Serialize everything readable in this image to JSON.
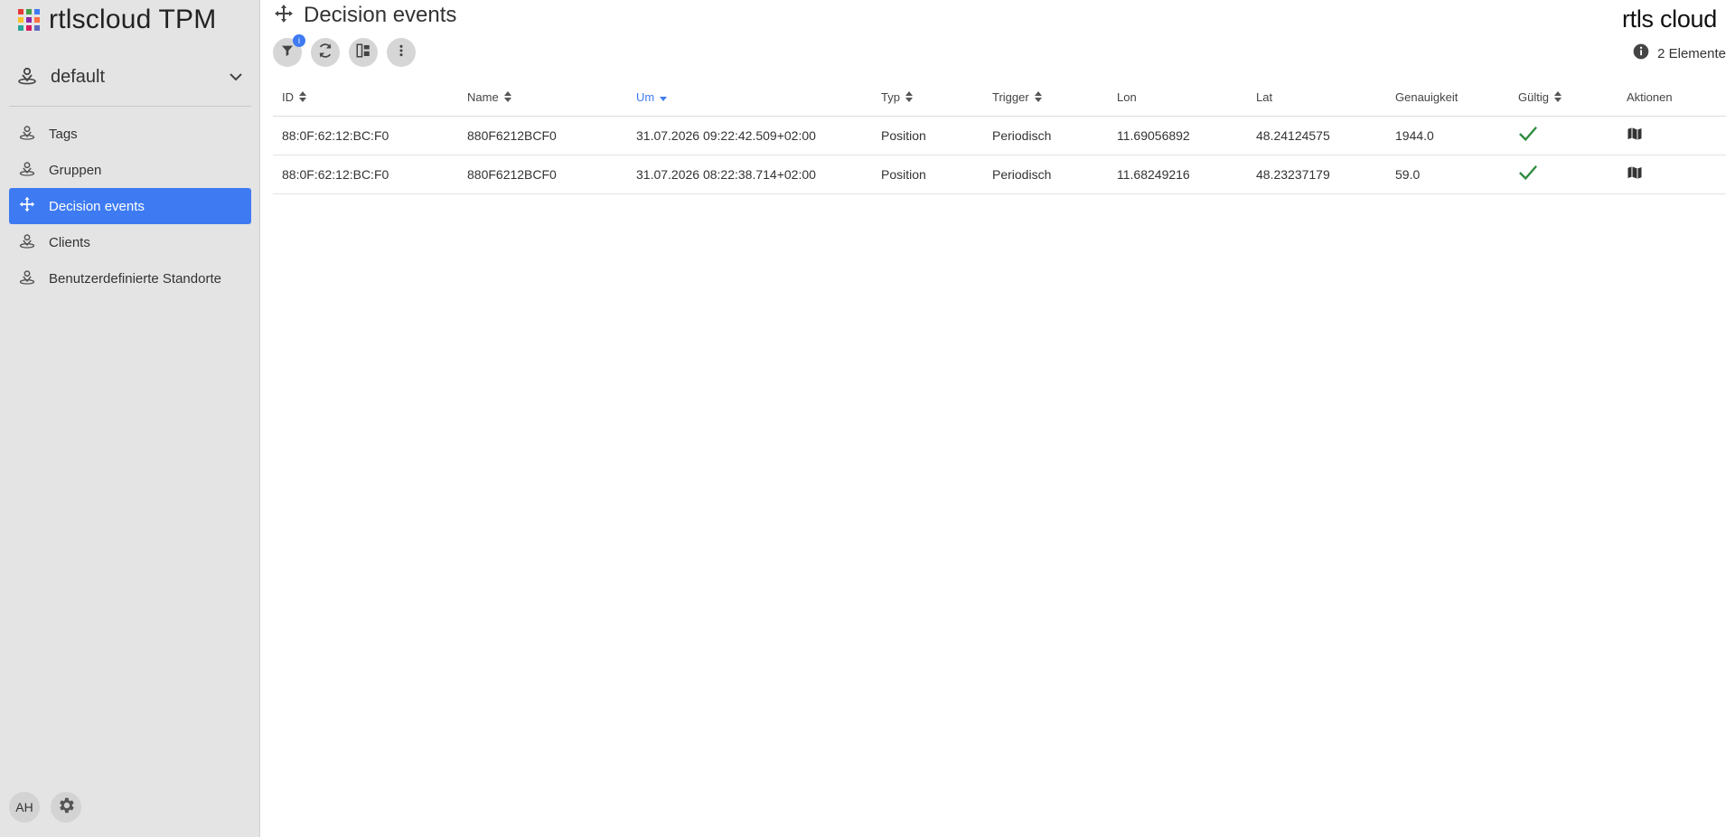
{
  "app": {
    "title": "rtlscloud TPM",
    "grid_colors": [
      "#e53935",
      "#43a047",
      "#3e7bf2",
      "#fbc02d",
      "#8e24aa",
      "#ff7043",
      "#26a69a",
      "#d81b60",
      "#5c6bc0"
    ]
  },
  "sidebar": {
    "org_select": {
      "value": "default"
    },
    "items": [
      {
        "label": "Tags",
        "icon": "location-person-icon",
        "active": false
      },
      {
        "label": "Gruppen",
        "icon": "location-person-icon",
        "active": false
      },
      {
        "label": "Decision events",
        "icon": "move-arrows-icon",
        "active": true
      },
      {
        "label": "Clients",
        "icon": "location-person-icon",
        "active": false
      },
      {
        "label": "Benutzerdefinierte Standorte",
        "icon": "location-person-icon",
        "active": false
      }
    ],
    "footer": {
      "avatar_initials": "AH",
      "settings_icon": "gear-icon"
    }
  },
  "header": {
    "title": "Decision events",
    "brand": "rtls cloud",
    "count_label": "2 Elemente"
  },
  "toolbar": {
    "filter_badge": "i",
    "buttons": [
      "filter-icon",
      "refresh-icon",
      "columns-icon",
      "more-vert-icon"
    ]
  },
  "table": {
    "columns": [
      {
        "label": "ID",
        "sortable": true,
        "sorted": false
      },
      {
        "label": "Name",
        "sortable": true,
        "sorted": false
      },
      {
        "label": "Um",
        "sortable": true,
        "sorted": true
      },
      {
        "label": "Typ",
        "sortable": true,
        "sorted": false
      },
      {
        "label": "Trigger",
        "sortable": true,
        "sorted": false
      },
      {
        "label": "Lon",
        "sortable": false,
        "sorted": false
      },
      {
        "label": "Lat",
        "sortable": false,
        "sorted": false
      },
      {
        "label": "Genauigkeit",
        "sortable": false,
        "sorted": false
      },
      {
        "label": "Gültig",
        "sortable": true,
        "sorted": false
      },
      {
        "label": "Aktionen",
        "sortable": false,
        "sorted": false
      }
    ],
    "rows": [
      {
        "id": "88:0F:62:12:BC:F0",
        "name": "880F6212BCF0",
        "um": "31.07.2026 09:22:42.509+02:00",
        "typ": "Position",
        "trigger": "Periodisch",
        "lon": "11.69056892",
        "lat": "48.24124575",
        "genauigkeit": "1944.0",
        "gueltig": true
      },
      {
        "id": "88:0F:62:12:BC:F0",
        "name": "880F6212BCF0",
        "um": "31.07.2026 08:22:38.714+02:00",
        "typ": "Position",
        "trigger": "Periodisch",
        "lon": "11.68249216",
        "lat": "48.23237179",
        "genauigkeit": "59.0",
        "gueltig": true
      }
    ]
  },
  "colors": {
    "accent": "#3e7bf2",
    "valid_check": "#2e8b3e",
    "sidebar_bg": "#e4e4e4"
  }
}
